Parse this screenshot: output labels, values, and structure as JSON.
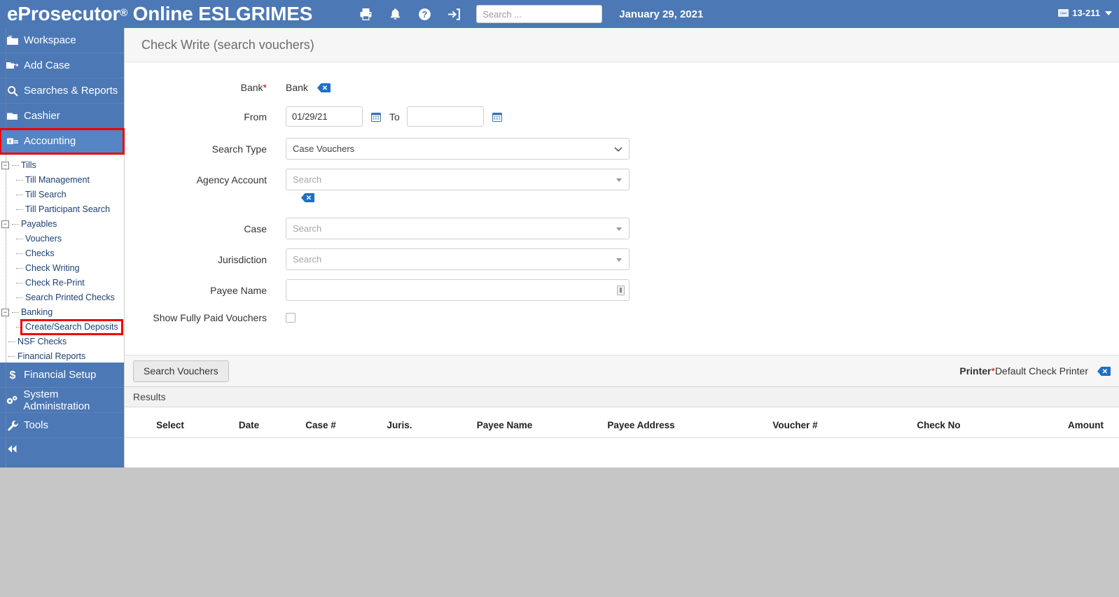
{
  "header": {
    "app_title_main": "eProsecutor",
    "app_title_reg": "®",
    "app_title_rest": " Online ESLGRIMES",
    "icons": [
      {
        "name": "printer-icon",
        "label": "Print"
      },
      {
        "name": "bell-icon",
        "label": "Notifications"
      },
      {
        "name": "help-icon",
        "label": "Help"
      },
      {
        "name": "logout-icon",
        "label": "Sign out"
      }
    ],
    "search_placeholder": "Search ...",
    "search_value": "",
    "date": "January 29, 2021",
    "case_number": "13-211",
    "brand_color": "#4c78b5"
  },
  "sidebar": {
    "nav": [
      {
        "label": "Workspace",
        "icon": "workspace-icon",
        "active": false,
        "highlight": false
      },
      {
        "label": "Add Case",
        "icon": "add-case-icon",
        "active": false,
        "highlight": false
      },
      {
        "label": "Searches & Reports",
        "icon": "search-icon",
        "active": false,
        "highlight": false
      },
      {
        "label": "Cashier",
        "icon": "cashier-icon",
        "active": false,
        "highlight": false
      },
      {
        "label": "Accounting",
        "icon": "accounting-icon",
        "active": true,
        "highlight": true
      }
    ],
    "tree": [
      {
        "label": "Tills",
        "level": 1,
        "expander": "-",
        "highlight": false
      },
      {
        "label": "Till Management",
        "level": 2,
        "expander": "",
        "highlight": false
      },
      {
        "label": "Till Search",
        "level": 2,
        "expander": "",
        "highlight": false
      },
      {
        "label": "Till Participant Search",
        "level": 2,
        "expander": "",
        "highlight": false
      },
      {
        "label": "Payables",
        "level": 1,
        "expander": "-",
        "highlight": false
      },
      {
        "label": "Vouchers",
        "level": 2,
        "expander": "",
        "highlight": false
      },
      {
        "label": "Checks",
        "level": 2,
        "expander": "",
        "highlight": false
      },
      {
        "label": "Check Writing",
        "level": 2,
        "expander": "",
        "highlight": false
      },
      {
        "label": "Check Re-Print",
        "level": 2,
        "expander": "",
        "highlight": false
      },
      {
        "label": "Search Printed Checks",
        "level": 2,
        "expander": "",
        "highlight": false
      },
      {
        "label": "Banking",
        "level": 1,
        "expander": "-",
        "highlight": false
      },
      {
        "label": "Create/Search Deposits",
        "level": 2,
        "expander": "",
        "highlight": true
      },
      {
        "label": "NSF Checks",
        "level": 1,
        "expander": "",
        "highlight": false
      },
      {
        "label": "Financial Reports",
        "level": 1,
        "expander": "",
        "highlight": false
      }
    ],
    "nav_bottom": [
      {
        "label": "Financial Setup",
        "icon": "dollar-icon"
      },
      {
        "label": "System Administration",
        "icon": "gears-icon"
      },
      {
        "label": "Tools",
        "icon": "wrench-icon"
      }
    ],
    "collapse_label": "Collapse menu",
    "highlight_color": "#ee0000"
  },
  "main": {
    "page_title": "Check Write (search vouchers)",
    "fields": {
      "bank_label": "Bank",
      "bank_required": "*",
      "bank_value": "Bank",
      "from_label": "From",
      "from_value": "01/29/21",
      "to_label": "To",
      "to_value": "",
      "search_type_label": "Search Type",
      "search_type_value": "Case Vouchers",
      "search_type_options": [
        "Case Vouchers"
      ],
      "agency_account_label": "Agency Account",
      "agency_account_placeholder": "Search",
      "agency_account_value": "",
      "case_label": "Case",
      "case_placeholder": "Search",
      "case_value": "",
      "jurisdiction_label": "Jurisdiction",
      "jurisdiction_placeholder": "Search",
      "jurisdiction_value": "",
      "payee_name_label": "Payee Name",
      "payee_name_value": "",
      "show_fully_paid_label": "Show Fully Paid Vouchers",
      "show_fully_paid_checked": false
    },
    "actions": {
      "search_vouchers_label": "Search Vouchers",
      "printer_label": "Printer",
      "printer_required": "*",
      "printer_value": "Default Check Printer"
    },
    "results": {
      "section_label": "Results",
      "columns": [
        "Select",
        "Date",
        "Case #",
        "Juris.",
        "Payee Name",
        "Payee Address",
        "Voucher #",
        "Check No",
        "Amount"
      ],
      "rows": []
    }
  }
}
